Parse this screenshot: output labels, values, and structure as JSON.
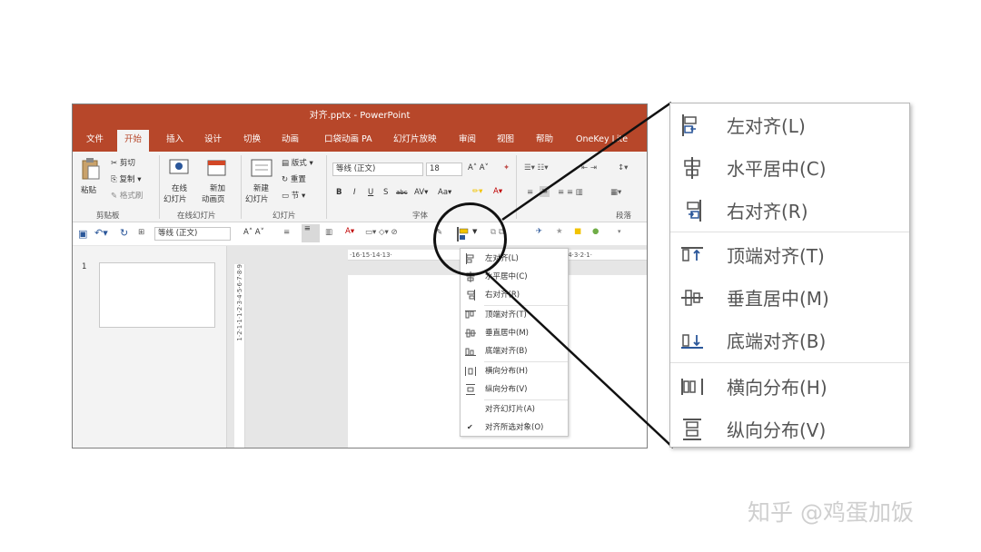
{
  "window": {
    "title": "对齐.pptx  -  PowerPoint"
  },
  "tabs": [
    "文件",
    "开始",
    "插入",
    "设计",
    "切换",
    "动画",
    "口袋动画 PA",
    "幻灯片放映",
    "审阅",
    "视图",
    "帮助",
    "OneKey Lite"
  ],
  "ribbon": {
    "clipboard": {
      "paste": "粘贴",
      "cut": "剪切",
      "copy": "复制",
      "format_painter": "格式刷",
      "label": "剪贴板"
    },
    "online": {
      "online_slides": "在线",
      "online_slides2": "幻灯片",
      "new_anim": "新加",
      "new_anim2": "动画页",
      "label": "在线幻灯片"
    },
    "slides": {
      "new_slide": "新建",
      "new_slide2": "幻灯片",
      "layout": "版式",
      "reset": "重置",
      "section": "节",
      "label": "幻灯片"
    },
    "font": {
      "font_name": "等线 (正文)",
      "font_size": "18",
      "label": "字体"
    },
    "paragraph": {
      "label": "段落"
    }
  },
  "qat": {
    "font_name": "等线 (正文)"
  },
  "slide_panel": {
    "slide_number": "1"
  },
  "ruler": {
    "top": "·16·15·14·13·",
    "right": "·4·3·2·1·",
    "left": "1·2·1·1·1·2·3·4·5·6·7·8·9"
  },
  "small_menu": {
    "items": [
      "左对齐(L)",
      "水平居中(C)",
      "右对齐(R)",
      "顶端对齐(T)",
      "垂直居中(M)",
      "底端对齐(B)",
      "横向分布(H)",
      "纵向分布(V)",
      "对齐幻灯片(A)",
      "对齐所选对象(O)"
    ],
    "checked_mark": "✔"
  },
  "zoom_menu": {
    "items": [
      "左对齐(L)",
      "水平居中(C)",
      "右对齐(R)",
      "顶端对齐(T)",
      "垂直居中(M)",
      "底端对齐(B)",
      "横向分布(H)",
      "纵向分布(V)"
    ]
  },
  "watermark": "知乎 @鸡蛋加饭",
  "colors": {
    "ppt_brand": "#b7472a",
    "icon_blue": "#2b579a",
    "icon_gray": "#555555"
  }
}
